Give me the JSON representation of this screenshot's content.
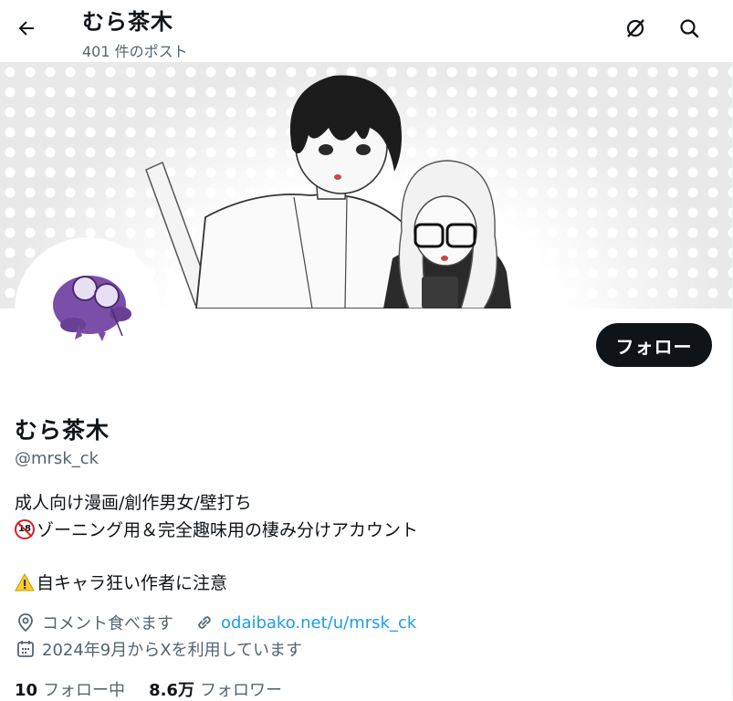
{
  "header": {
    "title": "むら茶木",
    "post_count": "401 件のポスト"
  },
  "profile": {
    "name": "むら茶木",
    "handle": "@mrsk_ck",
    "follow_label": "フォロー",
    "bio": {
      "line1": "成人向け漫画/創作男女/壁打ち",
      "line2_badge": "18",
      "line2": "ゾーニング用＆完全趣味用の棲み分けアカウント",
      "line3": "自キャラ狂い作者に注意"
    },
    "location": "コメント食べます",
    "website": "odaibako.net/u/mrsk_ck",
    "joined": "2024年9月からXを利用しています",
    "following_count": "10",
    "following_label": "フォロー中",
    "followers_count": "8.6万",
    "followers_label": "フォロワー"
  },
  "icons": {
    "back": "arrow-left-icon",
    "grok": "grok-icon",
    "search": "search-icon",
    "location": "location-pin-icon",
    "link": "link-icon",
    "calendar": "calendar-icon",
    "warning": "warning-icon",
    "no-under-18": "no-under-18-icon"
  },
  "colors": {
    "text": "#0f1419",
    "secondary": "#536471",
    "link": "#1d9bf0",
    "button": "#0f1419",
    "avatar_purple": "#7b4fa8"
  }
}
